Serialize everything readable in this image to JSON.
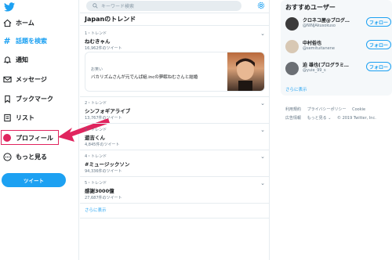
{
  "nav": {
    "items": [
      {
        "label": "ホーム",
        "icon": "home-icon"
      },
      {
        "label": "話題を検索",
        "icon": "hashtag-icon"
      },
      {
        "label": "通知",
        "icon": "bell-icon"
      },
      {
        "label": "メッセージ",
        "icon": "envelope-icon"
      },
      {
        "label": "ブックマーク",
        "icon": "bookmark-icon"
      },
      {
        "label": "リスト",
        "icon": "list-icon"
      },
      {
        "label": "プロフィール",
        "icon": "avatar-icon"
      },
      {
        "label": "もっと見る",
        "icon": "more-icon"
      }
    ],
    "tweet_button": "ツイート"
  },
  "search": {
    "placeholder": "キーワード検索"
  },
  "trends": {
    "title": "Japanのトレンド",
    "items": [
      {
        "rank": "1・トレンド",
        "name": "ねむきゃん",
        "count": "16,962件のツイート"
      },
      {
        "rank": "2・トレンド",
        "name": "シンフォギアライブ",
        "count": "13,767件のツイート"
      },
      {
        "rank": "3・トレンド",
        "name": "遊吉くん",
        "count": "4,845件のツイート"
      },
      {
        "rank": "4・トレンド",
        "name": "#ミュージックソン",
        "count": "94,336件のツイート"
      },
      {
        "rank": "5・トレンド",
        "name": "感謝3000億",
        "count": "27,687件のツイート"
      }
    ],
    "card": {
      "category": "お笑い",
      "headline": "バカリズムさんが元でんぱ組.incの夢眠ねむさんと結婚"
    },
    "more": "さらに表示"
  },
  "recommend": {
    "title": "おすすめユーザー",
    "users": [
      {
        "name": "クロネコ屋@ブログ…",
        "handle": "@NINJAkusokuso",
        "button": "フォロー"
      },
      {
        "name": "中村俗也",
        "handle": "@semituitanene",
        "button": "フォロー"
      },
      {
        "name": "迫 雄也(ブログラミ…",
        "handle": "@yuie_99_s",
        "button": "フォロー"
      }
    ],
    "more": "さらに表示"
  },
  "footer": {
    "line1": [
      "利用規約",
      "プライバシーポリシー",
      "Cookie"
    ],
    "line2": [
      "広告情報",
      "もっと見る ⌄",
      "© 2019 Twitter, Inc."
    ]
  },
  "colors": {
    "accent": "#1da1f2",
    "highlight": "#e0245e"
  }
}
